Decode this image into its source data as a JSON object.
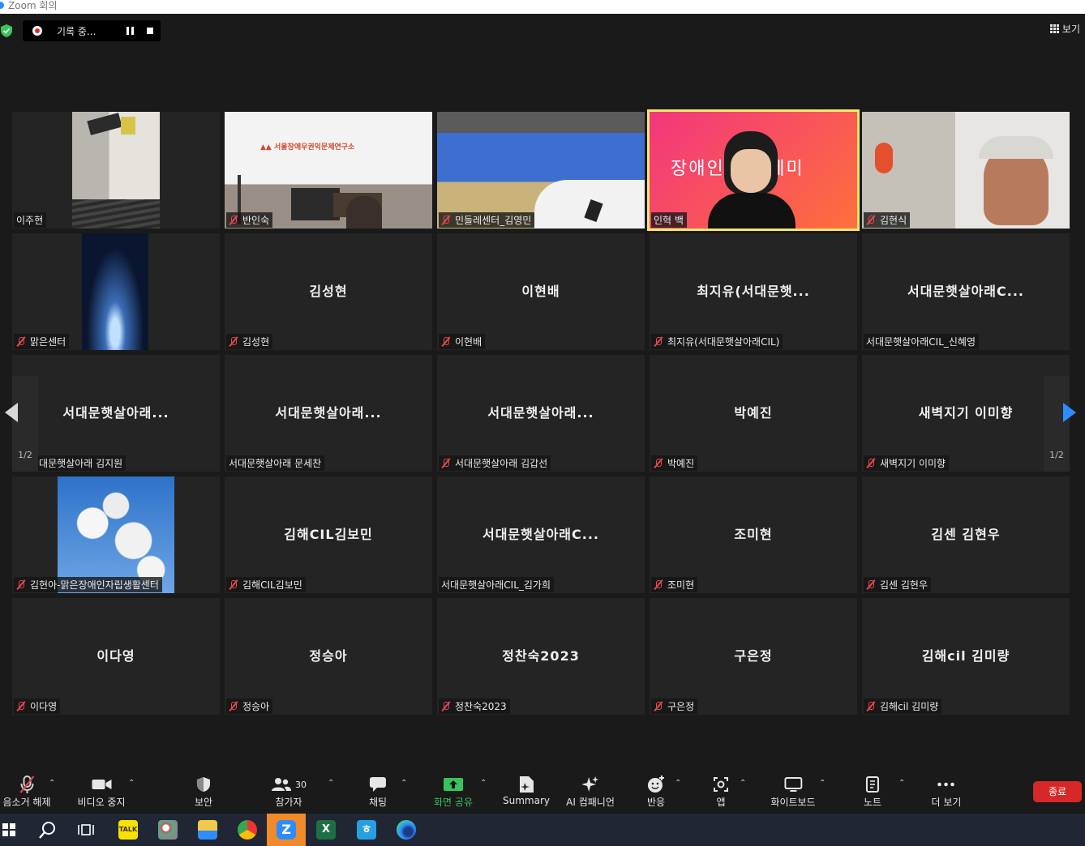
{
  "window": {
    "title": "Zoom 회의"
  },
  "recording": {
    "label": "기록 중..."
  },
  "view": {
    "label": "보기"
  },
  "pagination": {
    "left": "1/2",
    "right": "1/2"
  },
  "tiles": [
    {
      "label": "이주현",
      "muted": false,
      "video": "hallway"
    },
    {
      "label": "반인숙",
      "muted": true,
      "video": "office"
    },
    {
      "label": "민들레센터_김영민",
      "muted": true,
      "video": "pillow"
    },
    {
      "label": "인혁 백",
      "muted": false,
      "video": "academy",
      "active": true,
      "banner": "장애인 아카데미"
    },
    {
      "label": "김현식",
      "muted": true,
      "video": "man"
    },
    {
      "label": "맑은센터",
      "muted": true,
      "video": "earth"
    },
    {
      "name": "김성현",
      "label": "김성현",
      "muted": true
    },
    {
      "name": "이현배",
      "label": "이현배",
      "muted": true
    },
    {
      "name": "최지유(서대문햇...",
      "label": "최지유(서대문햇살아래CIL)",
      "muted": true
    },
    {
      "name": "서대문햇살아래C...",
      "label": "서대문햇살아래CIL_신혜영",
      "muted": false
    },
    {
      "name": "서대문햇살아래...",
      "label": "서대문햇살아래 김지원",
      "muted": true
    },
    {
      "name": "서대문햇살아래...",
      "label": "서대문햇살아래 문세찬",
      "muted": false
    },
    {
      "name": "서대문햇살아래...",
      "label": "서대문햇살아래 김갑선",
      "muted": true
    },
    {
      "name": "박예진",
      "label": "박예진",
      "muted": true
    },
    {
      "name": "새벽지기 이미향",
      "label": "새벽지기 이미향",
      "muted": true
    },
    {
      "label": "김현아-맑은장애인자립생활센터",
      "muted": true,
      "video": "blossom"
    },
    {
      "name": "김해CIL김보민",
      "label": "김해CIL김보민",
      "muted": true
    },
    {
      "name": "서대문햇살아래C...",
      "label": "서대문햇살아래CIL_김가희",
      "muted": false
    },
    {
      "name": "조미현",
      "label": "조미현",
      "muted": true
    },
    {
      "name": "김센 김현우",
      "label": "김센 김현우",
      "muted": true
    },
    {
      "name": "이다영",
      "label": "이다영",
      "muted": true
    },
    {
      "name": "정승아",
      "label": "정승아",
      "muted": true
    },
    {
      "name": "정찬숙2023",
      "label": "정찬숙2023",
      "muted": true
    },
    {
      "name": "구은정",
      "label": "구은정",
      "muted": true
    },
    {
      "name": "김해cil 김미량",
      "label": "김해cil 김미량",
      "muted": true
    }
  ],
  "toolbar": {
    "unmute": "음소거 해제",
    "stop_video": "비디오 중지",
    "security": "보안",
    "participants": "참가자",
    "participants_count": "30",
    "chat": "채팅",
    "share": "화면 공유",
    "summary": "Summary",
    "ai": "AI 컴패니언",
    "reactions": "반응",
    "apps": "앱",
    "whiteboard": "화이트보드",
    "notes": "노트",
    "more": "더 보기",
    "end": "종료"
  },
  "taskbar_icons": [
    "windows-start-icon",
    "search-icon",
    "task-view-icon",
    "kakaotalk-icon",
    "paint-icon",
    "file-explorer-icon",
    "chrome-icon",
    "zoom-icon",
    "excel-icon",
    "hangul-icon",
    "edge-icon"
  ],
  "colors": {
    "active_speaker": "#f3e86a",
    "muted": "#e5484d",
    "share": "#37c45c",
    "end": "#d72828",
    "accent": "#2d8cff"
  }
}
